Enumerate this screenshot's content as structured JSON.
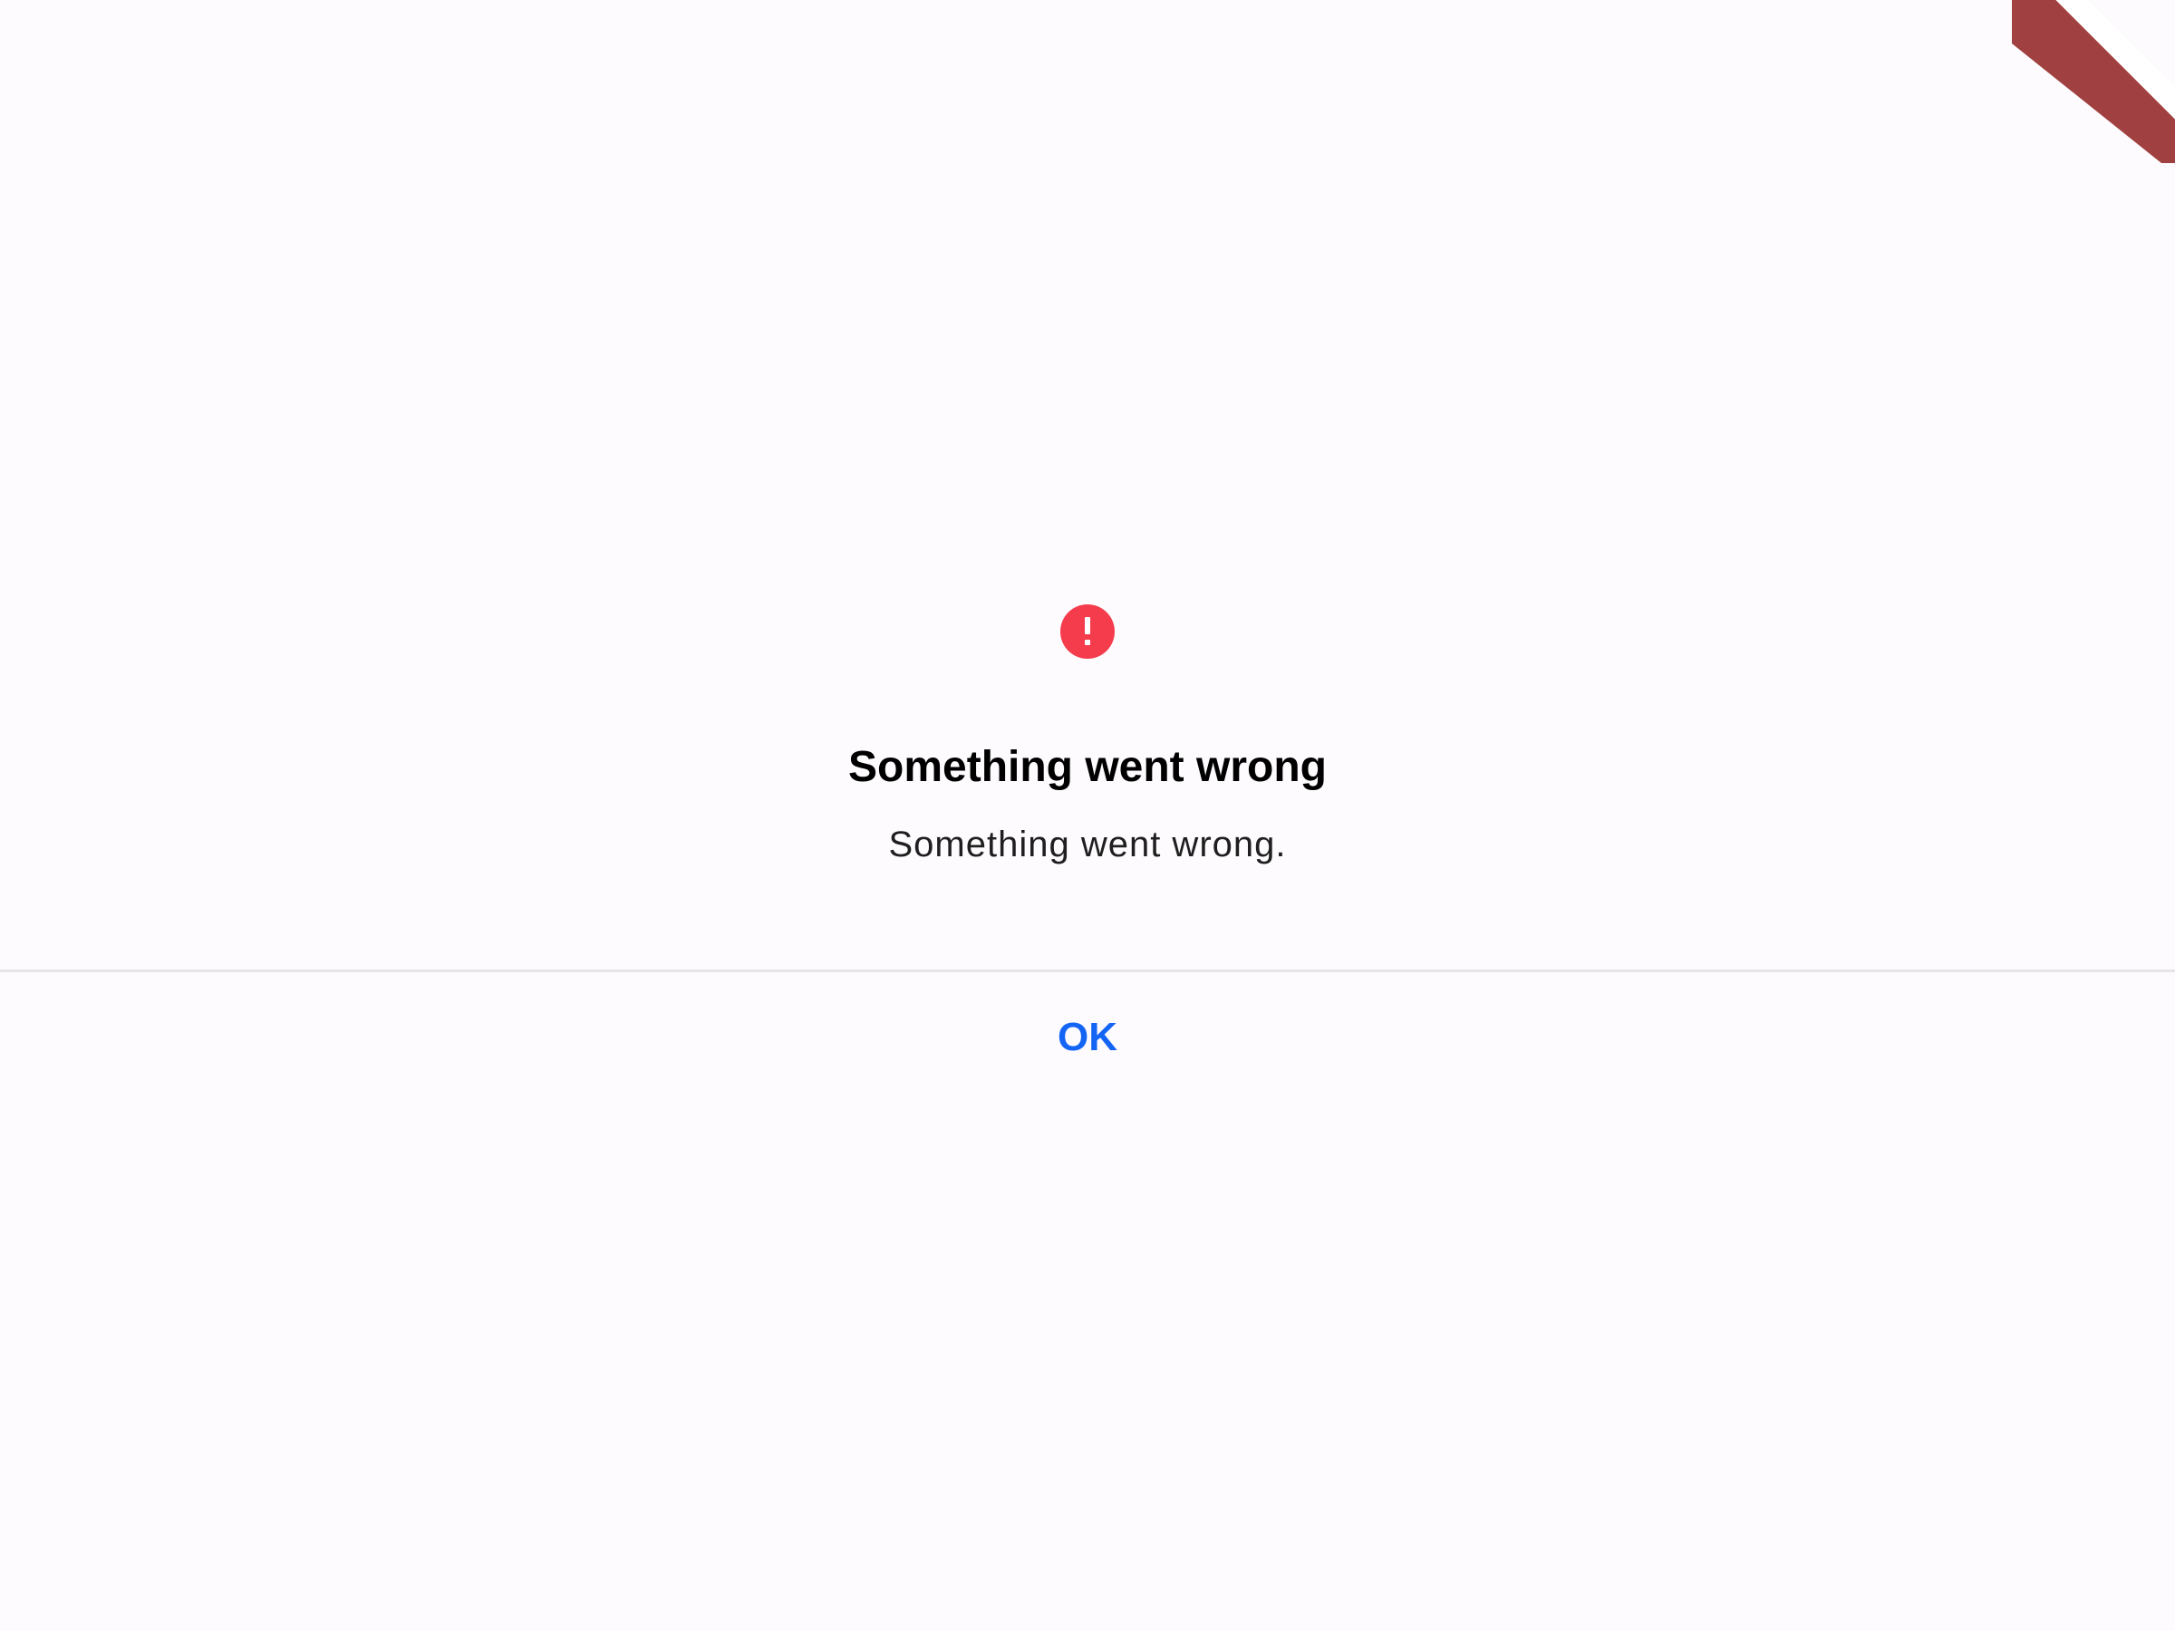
{
  "dialog": {
    "title": "Something went wrong",
    "message": "Something went wrong.",
    "ok_label": "OK",
    "icon": "error-icon"
  },
  "colors": {
    "background": "#fdfbfd",
    "error_icon": "#f43c4c",
    "ok_button_text": "#1565f5",
    "debug_banner": "#a04040",
    "divider": "#e6e4e6"
  }
}
